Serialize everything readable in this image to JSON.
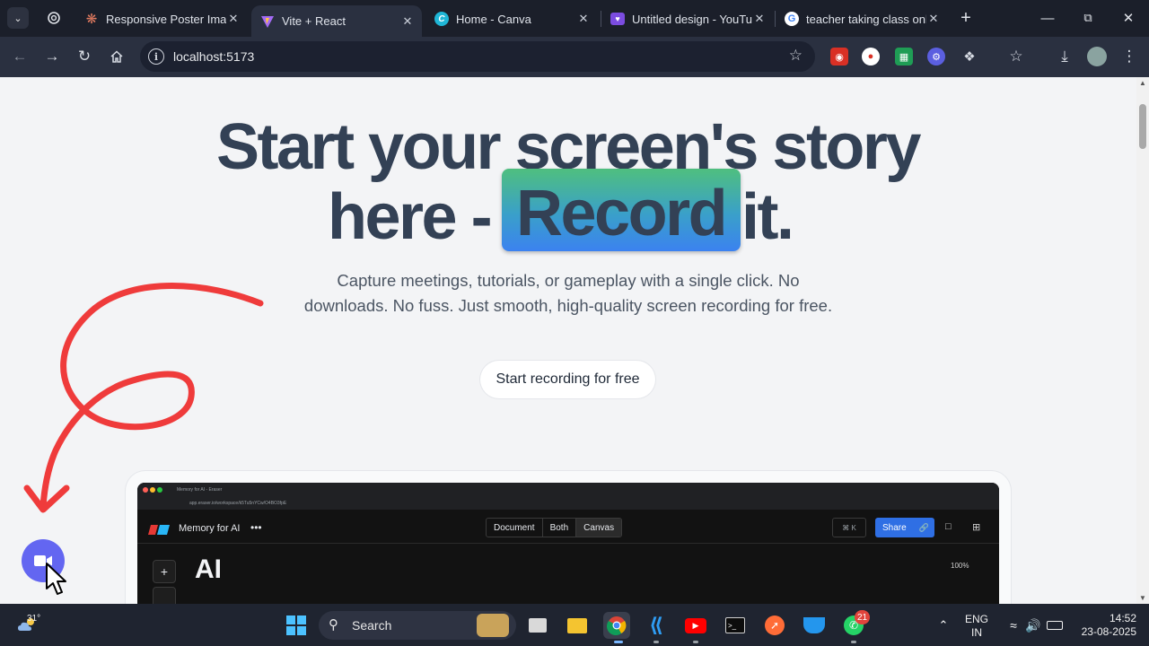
{
  "browser": {
    "tabs": [
      {
        "title": "Responsive Poster Imag",
        "icon": "claude-icon",
        "active": false
      },
      {
        "title": "Vite + React",
        "icon": "vite-icon",
        "active": true
      },
      {
        "title": "Home - Canva",
        "icon": "canva-icon",
        "active": false
      },
      {
        "title": "Untitled design - YouTu",
        "icon": "canva-heart-icon",
        "active": false
      },
      {
        "title": "teacher taking class onl",
        "icon": "google-icon",
        "active": false
      }
    ],
    "url": "localhost:5173"
  },
  "hero": {
    "line1": "Start your screen's story",
    "line2_prefix": "here -",
    "highlight": "Record",
    "line2_suffix": "it.",
    "subtitle": "Capture meetings, tutorials, or gameplay with a single click. No downloads. No fuss. Just smooth, high-quality screen recording for free.",
    "cta_label": "Start recording for free"
  },
  "preview": {
    "tab_title": "Memory for AI - Eraser",
    "tab_url": "app.eraser.io/workspace/k5Tu5nYCw/O4BO3fpE",
    "doc_title": "Memory for AI",
    "more": "•••",
    "segments": [
      "Document",
      "Both",
      "Canvas"
    ],
    "shortcut": "⌘ K",
    "share_label": "Share",
    "heading": "AI",
    "zoom": "100%"
  },
  "taskbar": {
    "weather_temp": "31°",
    "search_label": "Search",
    "lang_line1": "ENG",
    "lang_line2": "IN",
    "time": "14:52",
    "date": "23-08-2025",
    "whatsapp_badge": "21"
  },
  "colors": {
    "accent_fab": "#6366f1",
    "scribble": "#ef3b3b",
    "hero_text": "#334155",
    "share_button": "#2f6fe4"
  }
}
